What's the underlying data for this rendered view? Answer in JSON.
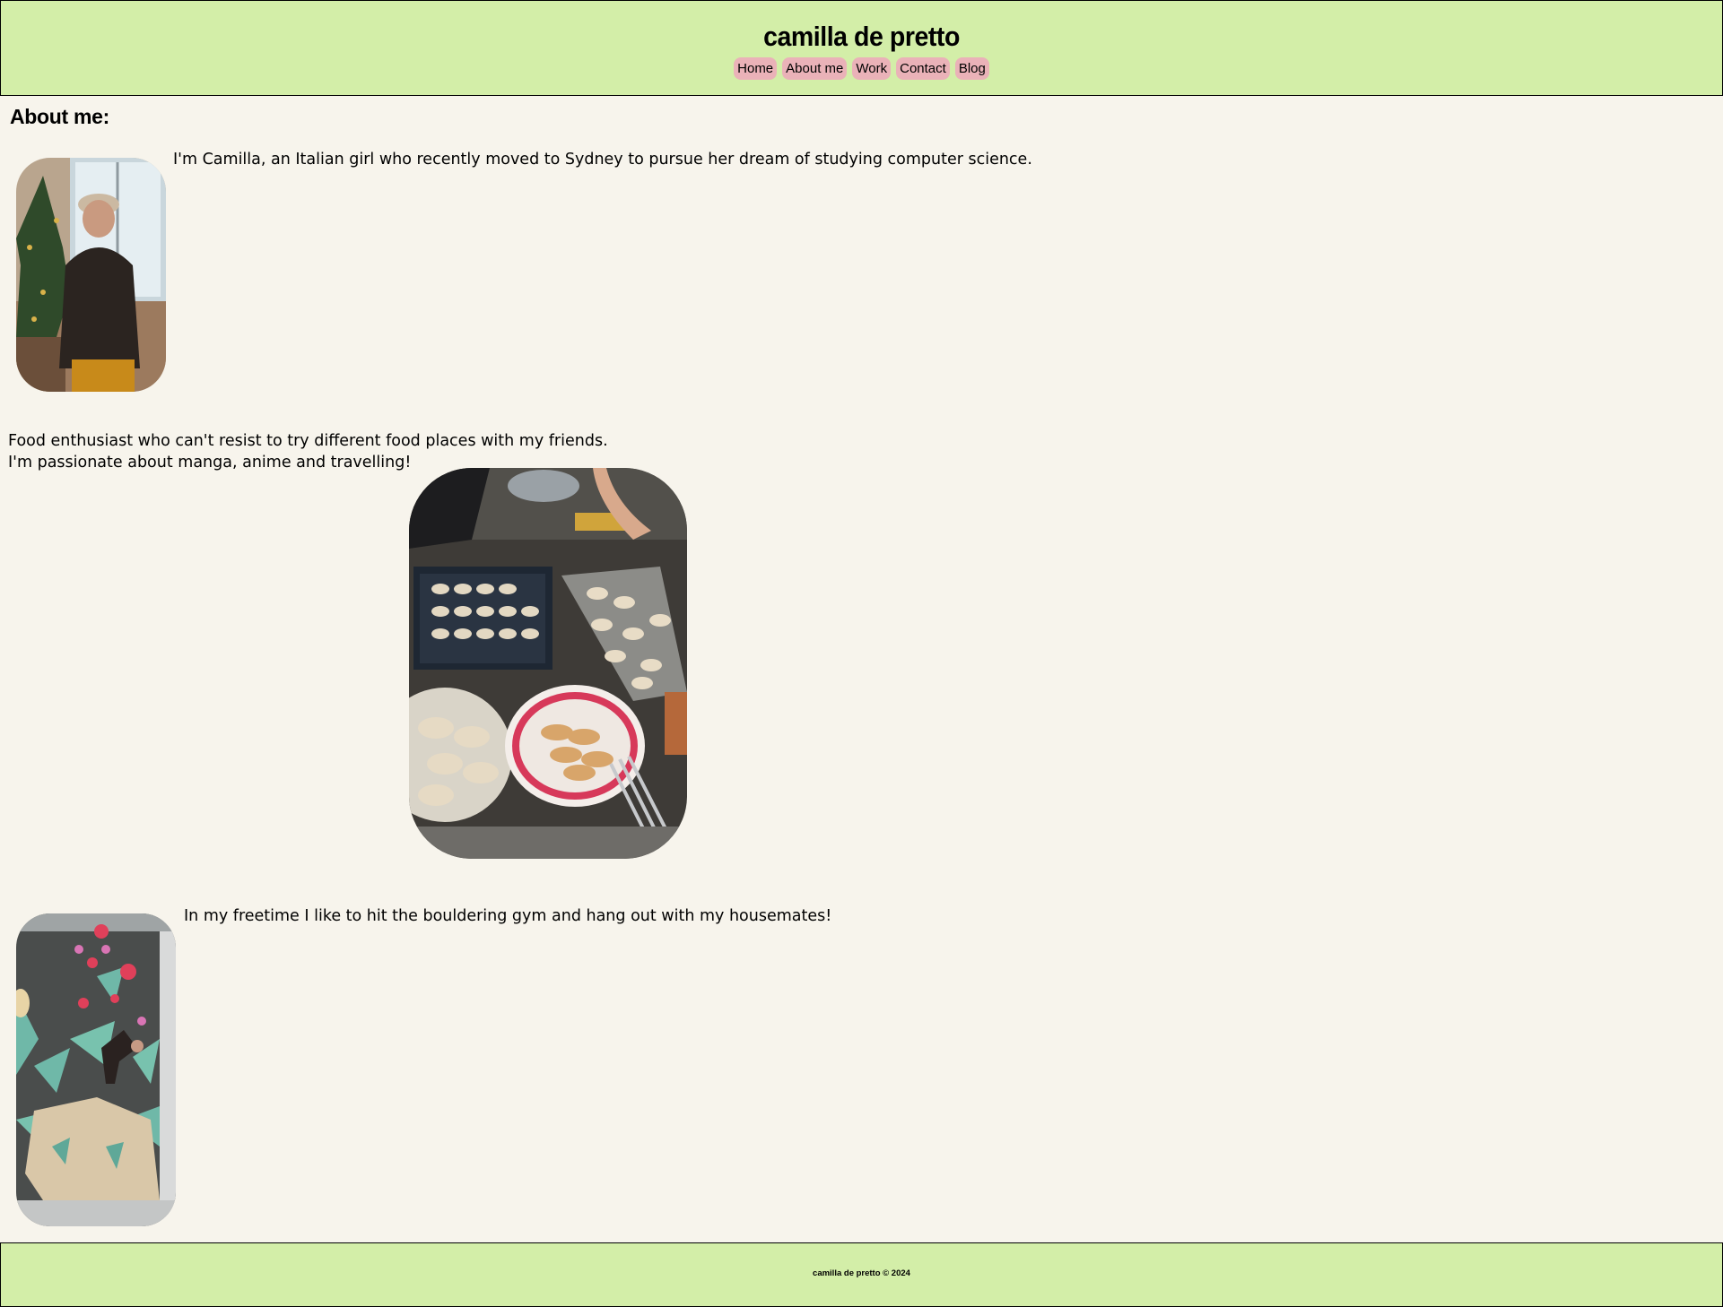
{
  "header": {
    "title": "camilla de pretto",
    "nav": [
      {
        "label": "Home"
      },
      {
        "label": "About me"
      },
      {
        "label": "Work"
      },
      {
        "label": "Contact"
      },
      {
        "label": "Blog"
      }
    ]
  },
  "main": {
    "section_title": "About me:",
    "intro_text": "I'm Camilla, an Italian girl who recently moved to Sydney to pursue her dream of studying computer science.",
    "food_line_1": "Food enthusiast who can't resist to try different food places with my friends.",
    "food_line_2": "I'm passionate about manga, anime and travelling!",
    "freetime_text": "In my freetime I like to hit the bouldering gym and hang out with my housemates!"
  },
  "footer": {
    "text": "camilla de pretto © 2024"
  },
  "colors": {
    "header_bg": "#d3eea8",
    "page_bg": "#f7f4ec",
    "nav_pill": "#eab2b8"
  }
}
